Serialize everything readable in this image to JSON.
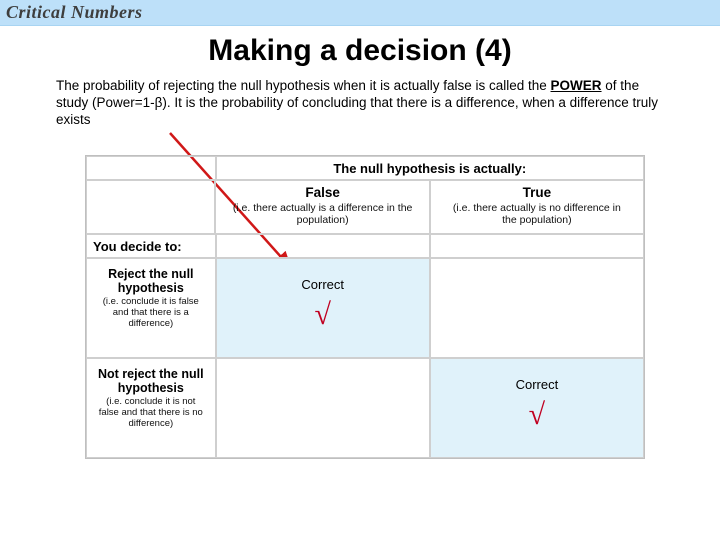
{
  "banner": {
    "title": "Critical Numbers"
  },
  "title": "Making a decision (4)",
  "body": {
    "pre": "The probability of rejecting the null hypothesis when it is actually false is called the ",
    "power": "POWER",
    "post": " of the study (Power=1-β). It is the probability of concluding that there is a difference, when a difference truly exists"
  },
  "table": {
    "col_header": "The null hypothesis is actually:",
    "row_header": "You decide to:",
    "cols": [
      {
        "label": "False",
        "paren": "(i.e. there actually is a difference in the population)"
      },
      {
        "label": "True",
        "paren": "(i.e. there actually is no difference in the population)"
      }
    ],
    "rows": [
      {
        "label": "Reject the null hypothesis",
        "paren": "(i.e. conclude it is false and that there is a difference)"
      },
      {
        "label": "Not reject the null hypothesis",
        "paren": "(i.e. conclude it is not false and that there is no difference)"
      }
    ],
    "cells": {
      "c00": "Correct",
      "c11": "Correct",
      "tick": "√"
    }
  }
}
